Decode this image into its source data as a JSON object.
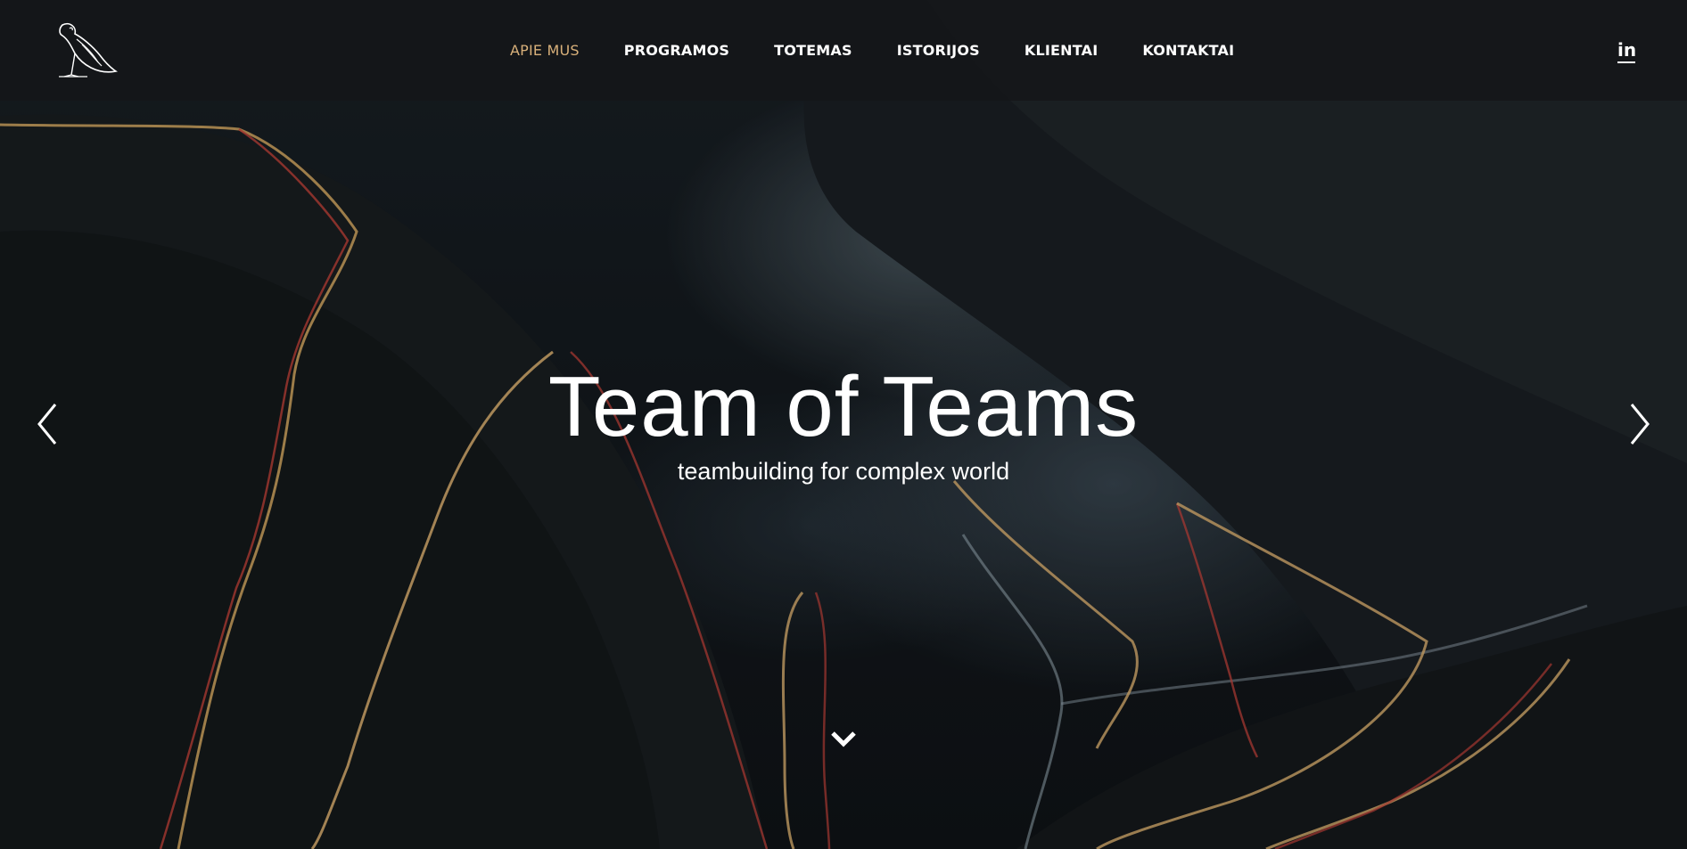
{
  "colors": {
    "accent": "#d8b07a",
    "text": "#ffffff",
    "header_bg": "#141618"
  },
  "header": {
    "logo_icon": "bird-logo-icon",
    "nav": [
      {
        "label": "APIE MUS",
        "active": true
      },
      {
        "label": "PROGRAMOS",
        "active": false
      },
      {
        "label": "TOTEMAS",
        "active": false
      },
      {
        "label": "ISTORIJOS",
        "active": false
      },
      {
        "label": "KLIENTAI",
        "active": false
      },
      {
        "label": "KONTAKTAI",
        "active": false
      }
    ],
    "social": {
      "label": "in",
      "icon": "linkedin-icon"
    }
  },
  "hero": {
    "title": "Team of Teams",
    "subtitle": "teambuilding for complex world",
    "prev_icon": "chevron-left-icon",
    "next_icon": "chevron-right-icon",
    "scroll_icon": "chevron-down-icon"
  }
}
